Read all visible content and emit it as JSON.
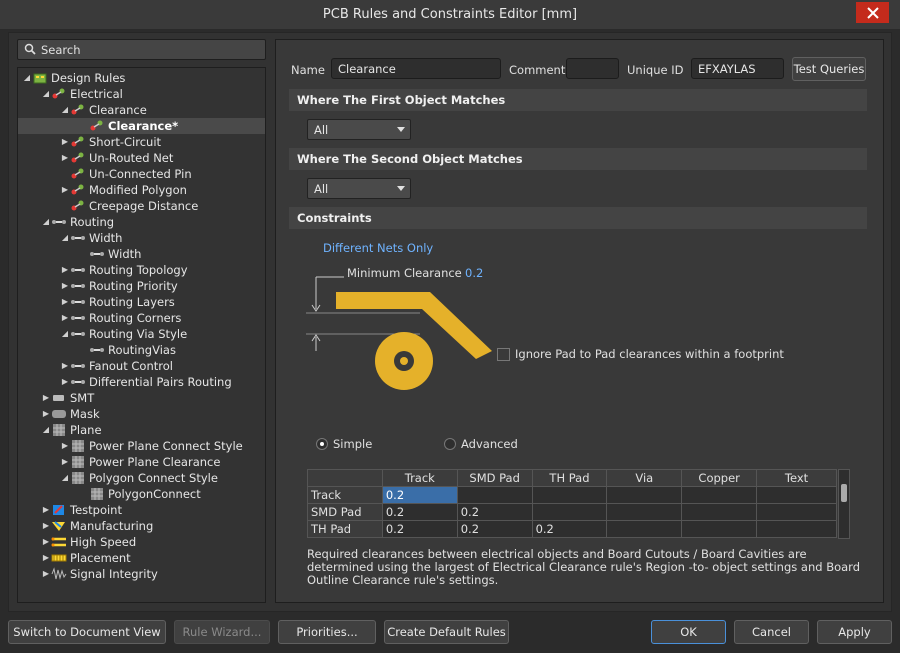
{
  "window": {
    "title": "PCB Rules and Constraints Editor [mm]"
  },
  "search": {
    "placeholder": "Search"
  },
  "tree": [
    {
      "label": "Design Rules",
      "arrow": "down",
      "icon": "design-rules-icon"
    },
    {
      "label": "Electrical",
      "arrow": "down",
      "icon": "electrical-rule-icon"
    },
    {
      "label": "Clearance",
      "arrow": "down",
      "icon": "electrical-rule-icon"
    },
    {
      "label": "Clearance*",
      "arrow": "",
      "icon": "electrical-rule-icon",
      "selected": true
    },
    {
      "label": "Short-Circuit",
      "arrow": "right",
      "icon": "electrical-rule-icon"
    },
    {
      "label": "Un-Routed Net",
      "arrow": "right",
      "icon": "electrical-rule-icon"
    },
    {
      "label": "Un-Connected Pin",
      "arrow": "",
      "icon": "electrical-rule-icon"
    },
    {
      "label": "Modified Polygon",
      "arrow": "right",
      "icon": "electrical-rule-icon"
    },
    {
      "label": "Creepage Distance",
      "arrow": "",
      "icon": "electrical-rule-icon"
    },
    {
      "label": "Routing",
      "arrow": "down",
      "icon": "routing-rule-icon"
    },
    {
      "label": "Width",
      "arrow": "down",
      "icon": "routing-rule-icon"
    },
    {
      "label": "Width",
      "arrow": "",
      "icon": "routing-rule-icon"
    },
    {
      "label": "Routing Topology",
      "arrow": "right",
      "icon": "routing-rule-icon"
    },
    {
      "label": "Routing Priority",
      "arrow": "right",
      "icon": "routing-rule-icon"
    },
    {
      "label": "Routing Layers",
      "arrow": "right",
      "icon": "routing-rule-icon"
    },
    {
      "label": "Routing Corners",
      "arrow": "right",
      "icon": "routing-rule-icon"
    },
    {
      "label": "Routing Via Style",
      "arrow": "down",
      "icon": "routing-rule-icon"
    },
    {
      "label": "RoutingVias",
      "arrow": "",
      "icon": "routing-rule-icon"
    },
    {
      "label": "Fanout Control",
      "arrow": "right",
      "icon": "routing-rule-icon"
    },
    {
      "label": "Differential Pairs Routing",
      "arrow": "right",
      "icon": "routing-rule-icon"
    },
    {
      "label": "SMT",
      "arrow": "right",
      "icon": "smt-rule-icon"
    },
    {
      "label": "Mask",
      "arrow": "right",
      "icon": "mask-rule-icon"
    },
    {
      "label": "Plane",
      "arrow": "down",
      "icon": "plane-rule-icon"
    },
    {
      "label": "Power Plane Connect Style",
      "arrow": "right",
      "icon": "plane-rule-icon"
    },
    {
      "label": "Power Plane Clearance",
      "arrow": "right",
      "icon": "plane-rule-icon"
    },
    {
      "label": "Polygon Connect Style",
      "arrow": "down",
      "icon": "plane-rule-icon"
    },
    {
      "label": "PolygonConnect",
      "arrow": "",
      "icon": "plane-rule-icon"
    },
    {
      "label": "Testpoint",
      "arrow": "right",
      "icon": "testpoint-rule-icon"
    },
    {
      "label": "Manufacturing",
      "arrow": "right",
      "icon": "manufacturing-rule-icon"
    },
    {
      "label": "High Speed",
      "arrow": "right",
      "icon": "high-speed-rule-icon"
    },
    {
      "label": "Placement",
      "arrow": "right",
      "icon": "placement-rule-icon"
    },
    {
      "label": "Signal Integrity",
      "arrow": "right",
      "icon": "signal-integrity-rule-icon"
    }
  ],
  "rule": {
    "name_label": "Name",
    "name_value": "Clearance",
    "comment_label": "Comment",
    "comment_value": "",
    "uid_label": "Unique ID",
    "uid_value": "EFXAYLAS",
    "test_queries": "Test Queries"
  },
  "first_match": {
    "header": "Where The First Object Matches",
    "value": "All"
  },
  "second_match": {
    "header": "Where The Second Object Matches",
    "value": "All"
  },
  "constraints": {
    "header": "Constraints",
    "different_nets": "Different Nets Only",
    "min_clearance_label": "Minimum Clearance",
    "min_clearance_value": "0.2",
    "ignore_pad_label": "Ignore Pad to Pad clearances within a footprint",
    "mode_simple": "Simple",
    "mode_advanced": "Advanced",
    "selected_mode": "Simple",
    "track_color": "#e5b12a"
  },
  "grid": {
    "columns": [
      "",
      "Track",
      "SMD Pad",
      "TH Pad",
      "Via",
      "Copper",
      "Text"
    ],
    "rows": [
      [
        "Track",
        "0.2",
        "",
        "",
        "",
        "",
        ""
      ],
      [
        "SMD Pad",
        "0.2",
        "0.2",
        "",
        "",
        "",
        ""
      ],
      [
        "TH Pad",
        "0.2",
        "0.2",
        "0.2",
        "",
        "",
        ""
      ]
    ]
  },
  "description": "Required clearances between electrical objects and Board Cutouts / Board Cavities are determined using the largest of Electrical Clearance rule's Region -to- object settings and Board Outline Clearance rule's settings.",
  "footer": {
    "switch_view": "Switch to Document View",
    "rule_wizard": "Rule Wizard...",
    "priorities": "Priorities...",
    "create_defaults": "Create Default Rules",
    "ok": "OK",
    "cancel": "Cancel",
    "apply": "Apply"
  }
}
